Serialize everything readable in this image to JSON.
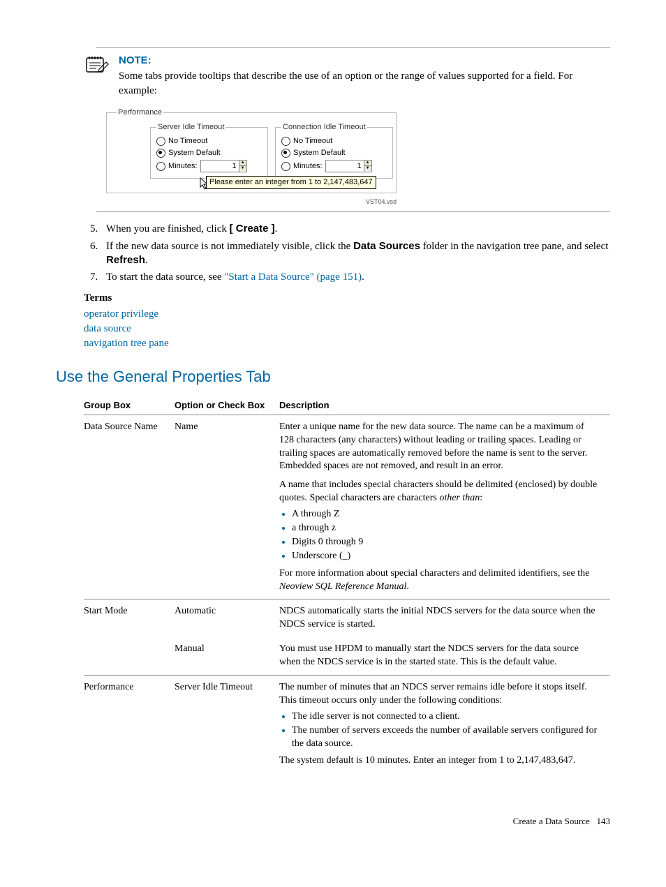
{
  "note": {
    "title": "NOTE:",
    "body": "Some tabs provide tooltips that describe the use of an option or the range of values supported for a field. For example:"
  },
  "dialog": {
    "outer_legend": "Performance",
    "server_group_legend": "Server Idle Timeout",
    "conn_group_legend": "Connection Idle Timeout",
    "opt_no_timeout": "No Timeout",
    "opt_sys_default": "System Default",
    "opt_minutes": "Minutes:",
    "spin_value_1": "1",
    "spin_value_2": "1",
    "tooltip_text": "Please enter an integer from 1 to 2,147,483,647",
    "vsd": "VST04.vsd"
  },
  "steps": {
    "start": 5,
    "s5_a": "When you are finished, click ",
    "s5_b": "[ Create ]",
    "s5_c": ".",
    "s6_a": "If the new data source is not immediately visible, click the ",
    "s6_b": "Data Sources",
    "s6_c": " folder in the navigation tree pane, and select ",
    "s6_d": "Refresh",
    "s6_e": ".",
    "s7_a": "To start the data source, see ",
    "s7_link": "\"Start a Data Source\" (page 151)",
    "s7_b": "."
  },
  "terms": {
    "heading": "Terms",
    "t1": "operator privilege",
    "t2": "data source",
    "t3": "navigation tree pane"
  },
  "section_title": "Use the General Properties Tab",
  "table": {
    "h_group": "Group Box",
    "h_option": "Option or Check Box",
    "h_desc": "Description",
    "r1_group": "Data Source Name",
    "r1_option": "Name",
    "r1_desc_p1": "Enter a unique name for the new data source. The name can be a maximum of 128 characters (any characters) without leading or trailing spaces. Leading or trailing spaces are automatically removed before the name is sent to the server. Embedded spaces are not removed, and result in an error.",
    "r1_desc_p2a": "A name that includes special characters should be delimited (enclosed) by double quotes. Special characters are characters ",
    "r1_desc_p2em": "other than",
    "r1_desc_p2b": ":",
    "r1_li1": "A through Z",
    "r1_li2": "a through z",
    "r1_li3": "Digits 0 through 9",
    "r1_li4": "Underscore (_)",
    "r1_desc_p3a": "For more information about special characters and delimited identifiers, see the ",
    "r1_desc_p3em": "Neoview SQL Reference Manual",
    "r1_desc_p3b": ".",
    "r2_group": "Start Mode",
    "r2a_option": "Automatic",
    "r2a_desc": "NDCS automatically starts the initial NDCS servers for the data source when the NDCS service is started.",
    "r2b_option": "Manual",
    "r2b_desc": "You must use HPDM to manually start the NDCS servers for the data source when the NDCS service is in the started state. This is the default value.",
    "r3_group": "Performance",
    "r3_option": "Server Idle Timeout",
    "r3_desc_p1": "The number of minutes that an NDCS server remains idle before it stops itself. This timeout occurs only under the following conditions:",
    "r3_li1": "The idle server is not connected to a client.",
    "r3_li2": "The number of servers exceeds the number of available servers configured for the data source.",
    "r3_desc_p2": "The system default is 10 minutes. Enter an integer from 1 to 2,147,483,647."
  },
  "footer": {
    "label": "Create a Data Source",
    "page": "143"
  }
}
